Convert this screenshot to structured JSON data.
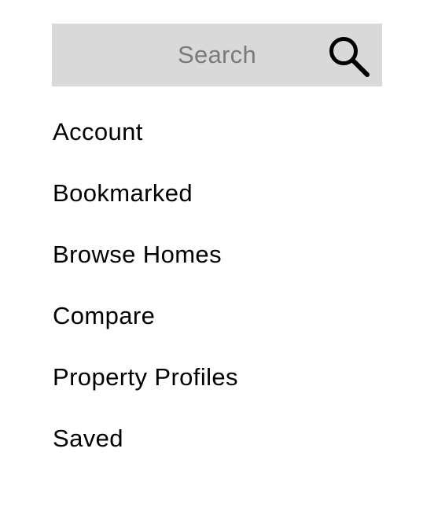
{
  "search": {
    "placeholder": "Search",
    "icon": "search-icon"
  },
  "menu": {
    "items": [
      {
        "label": "Account"
      },
      {
        "label": "Bookmarked"
      },
      {
        "label": "Browse Homes"
      },
      {
        "label": "Compare"
      },
      {
        "label": "Property Profiles"
      },
      {
        "label": "Saved"
      }
    ]
  },
  "colors": {
    "search_background": "#d9d9d9",
    "placeholder_text": "#7a7a7a",
    "text": "#000000",
    "background": "#ffffff"
  }
}
